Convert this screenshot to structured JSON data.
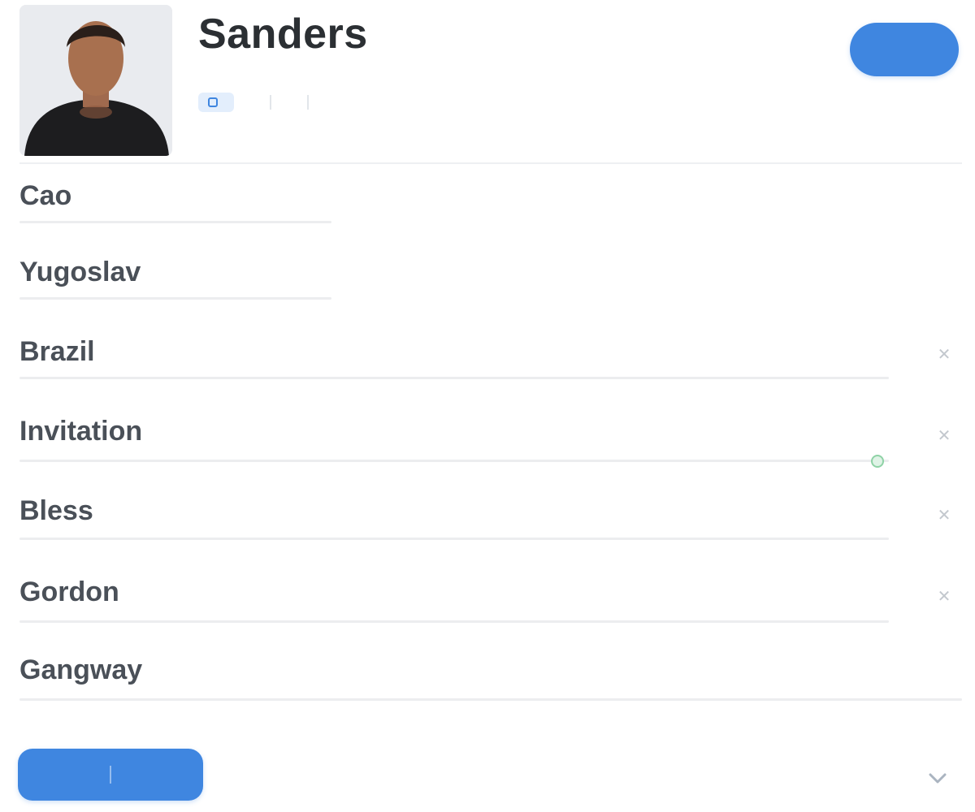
{
  "header": {
    "title": "Sanders",
    "primary_button": "",
    "status_badge": "",
    "meta_items": [
      "",
      "",
      ""
    ]
  },
  "fields": [
    {
      "label": "Cao"
    },
    {
      "label": "Yugoslav"
    },
    {
      "label": "Brazil"
    },
    {
      "label": "Invitation"
    },
    {
      "label": "Bless"
    },
    {
      "label": "Gordon"
    },
    {
      "label": "Gangway"
    }
  ],
  "footer": {
    "button_left": "",
    "button_right": ""
  },
  "colors": {
    "accent": "#3f86e0",
    "success": "#8fd2a6"
  },
  "icons": {
    "row_action": "close-icon",
    "footer": "chevron-icon"
  }
}
